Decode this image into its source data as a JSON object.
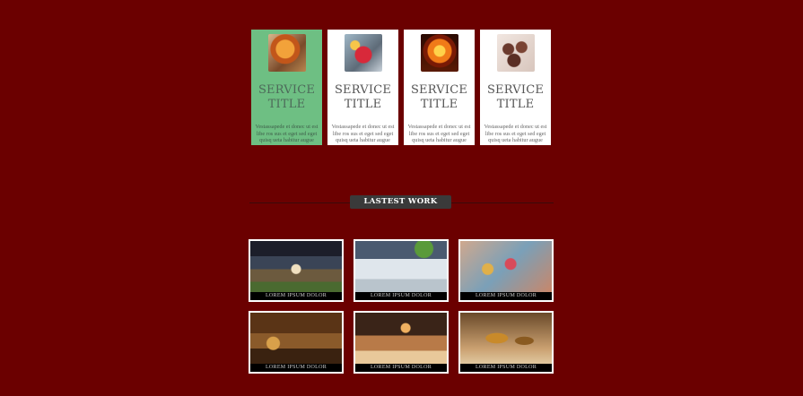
{
  "services": [
    {
      "title": "SERVICE TITLE",
      "text": "Vestassapede et donec ut est libe ros sus et eget sed eget quisq ueta habitur augue",
      "icon": "vegetable-dish-photo-icon",
      "active": true
    },
    {
      "title": "SERVICE TITLE",
      "text": "Vestassapede et donec ut est libe ros sus et eget sed eget quisq ueta habitur augue",
      "icon": "cocktail-drinks-photo-icon",
      "active": false
    },
    {
      "title": "SERVICE TITLE",
      "text": "Vestassapede et donec ut est libe ros sus et eget sed eget quisq ueta habitur augue",
      "icon": "grill-flame-photo-icon",
      "active": false
    },
    {
      "title": "SERVICE TITLE",
      "text": "Vestassapede et donec ut est libe ros sus et eget sed eget quisq ueta habitur augue",
      "icon": "cupcakes-photo-icon",
      "active": false
    }
  ],
  "latest_work": {
    "label": "LASTEST WORK",
    "items": [
      {
        "caption": "LOREM IPSUM DOLOR",
        "icon": "restaurant-bar-photo-icon"
      },
      {
        "caption": "LOREM IPSUM DOLOR",
        "icon": "banquet-table-photo-icon"
      },
      {
        "caption": "LOREM IPSUM DOLOR",
        "icon": "toast-drinks-photo-icon"
      },
      {
        "caption": "LOREM IPSUM DOLOR",
        "icon": "bakery-interior-photo-icon"
      },
      {
        "caption": "LOREM IPSUM DOLOR",
        "icon": "bread-display-photo-icon"
      },
      {
        "caption": "LOREM IPSUM DOLOR",
        "icon": "macarons-photo-icon"
      }
    ]
  },
  "colors": {
    "background": "#6b0000",
    "card_active": "#6ebf83",
    "card": "#ffffff",
    "label_bg": "#3a3a3a"
  }
}
